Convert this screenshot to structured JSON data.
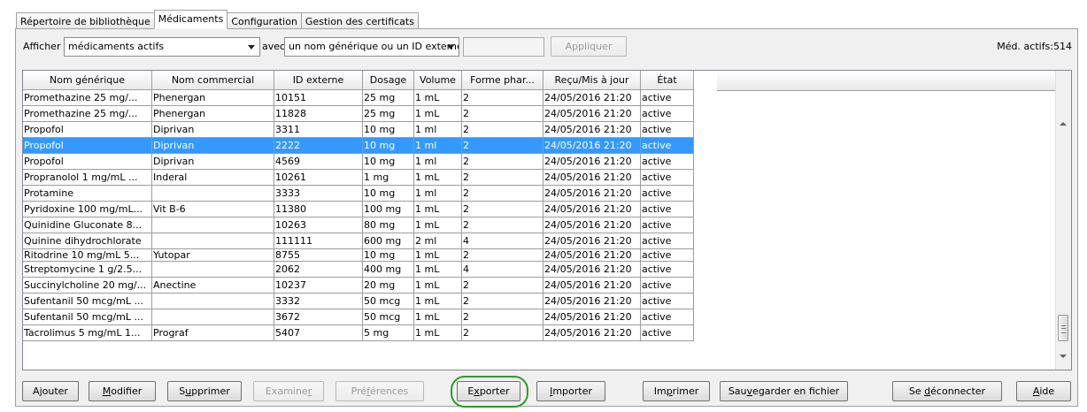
{
  "tabs": [
    {
      "label": "Répertoire de bibliothèque"
    },
    {
      "label": "Médicaments"
    },
    {
      "label": "Configuration"
    },
    {
      "label": "Gestion des certificats"
    }
  ],
  "filter": {
    "show_label": "Afficher",
    "show_value": "médicaments actifs",
    "with_label": "avec",
    "field_value": "un nom générique ou un ID externe",
    "search_value": "",
    "apply_label": "Appliquer",
    "active_count": "Méd. actifs:514"
  },
  "table": {
    "columns": [
      "Nom générique",
      "Nom commercial",
      "ID externe",
      "Dosage",
      "Volume",
      "Forme phar...",
      "Reçu/Mis à jour",
      "État"
    ],
    "rows": [
      [
        "Promethazine 25 mg/...",
        "Phenergan",
        "10151",
        "25 mg",
        "1 mL",
        "2",
        "24/05/2016 21:20",
        "active"
      ],
      [
        "Promethazine 25 mg/...",
        "Phenergan",
        "11828",
        "25 mg",
        "1 mL",
        "2",
        "24/05/2016 21:20",
        "active"
      ],
      [
        "Propofol",
        "Diprivan",
        "3311",
        "10 mg",
        "1 ml",
        "2",
        "24/05/2016 21:20",
        "active"
      ],
      [
        "Propofol",
        "Diprivan",
        "2222",
        "10 mg",
        "1 ml",
        "2",
        "24/05/2016 21:20",
        "active"
      ],
      [
        "Propofol",
        "Diprivan",
        "4569",
        "10 mg",
        "1 ml",
        "2",
        "24/05/2016 21:20",
        "active"
      ],
      [
        "Propranolol 1 mg/mL ...",
        "Inderal",
        "10261",
        "1 mg",
        "1 mL",
        "2",
        "24/05/2016 21:20",
        "active"
      ],
      [
        "Protamine",
        "",
        "3333",
        "10 mg",
        "1 ml",
        "2",
        "24/05/2016 21:20",
        "active"
      ],
      [
        "Pyridoxine 100 mg/mL...",
        "Vit B-6",
        "11380",
        "100 mg",
        "1 mL",
        "2",
        "24/05/2016 21:20",
        "active"
      ],
      [
        "Quinidine Gluconate 8...",
        "",
        "10263",
        "80 mg",
        "1 mL",
        "2",
        "24/05/2016 21:20",
        "active"
      ],
      [
        "Quinine dihydrochlorate",
        "",
        "111111",
        "600 mg",
        "2 ml",
        "4",
        "24/05/2016 21:20",
        "active"
      ],
      [
        "Ritodrine 10 mg/mL 5...",
        "Yutopar",
        "8755",
        "10 mg",
        "1 mL",
        "2",
        "24/05/2016 21:20",
        "active"
      ],
      [
        "Streptomycine 1 g/2.5...",
        "",
        "2062",
        "400 mg",
        "1 mL",
        "4",
        "24/05/2016 21:20",
        "active"
      ],
      [
        "Succinylcholine 20 mg/...",
        "Anectine",
        "10237",
        "20 mg",
        "1 mL",
        "2",
        "24/05/2016 21:20",
        "active"
      ],
      [
        "Sufentanil 50 mcg/mL ...",
        "",
        "3332",
        "50 mcg",
        "1 mL",
        "2",
        "24/05/2016 21:20",
        "active"
      ],
      [
        "Sufentanil 50 mcg/mL ...",
        "",
        "3672",
        "50 mcg",
        "1 mL",
        "2",
        "24/05/2016 21:20",
        "active"
      ],
      [
        "Tacrolimus 5 mg/mL 1...",
        "Prograf",
        "5407",
        "5 mg",
        "1 mL",
        "2",
        "24/05/2016 21:20",
        "active"
      ]
    ],
    "selected_row": 3
  },
  "buttons": {
    "add": {
      "pre": "A",
      "u": "j",
      "post": "outer"
    },
    "modify": {
      "pre": "",
      "u": "M",
      "post": "odifier"
    },
    "delete": {
      "pre": "S",
      "u": "u",
      "post": "pprimer"
    },
    "examine": {
      "pre": "Examine",
      "u": "r",
      "post": ""
    },
    "preferences": {
      "pre": "Pré",
      "u": "f",
      "post": "érences"
    },
    "export": {
      "pre": "E",
      "u": "x",
      "post": "porter"
    },
    "import": {
      "pre": "",
      "u": "I",
      "post": "mporter"
    },
    "print": {
      "pre": "Im",
      "u": "p",
      "post": "rimer"
    },
    "save": {
      "pre": "Sau",
      "u": "v",
      "post": "egarder en fichier"
    },
    "logout": {
      "pre": "Se ",
      "u": "d",
      "post": "éconnecter"
    },
    "help": {
      "pre": "",
      "u": "A",
      "post": "ide"
    }
  },
  "colors": {
    "selection": "#3399ff",
    "highlight_ring": "#2e9a2e"
  }
}
